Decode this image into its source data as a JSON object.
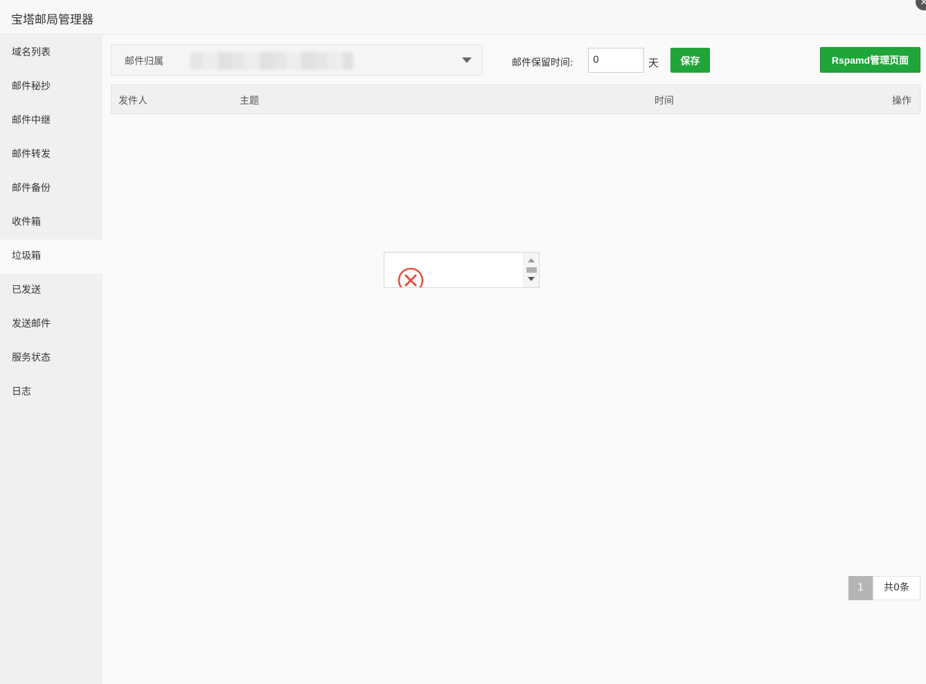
{
  "window": {
    "title": "宝塔邮局管理器",
    "close_symbol": "×"
  },
  "sidebar": {
    "items": [
      {
        "label": "域名列表"
      },
      {
        "label": "邮件秘抄"
      },
      {
        "label": "邮件中继"
      },
      {
        "label": "邮件转发"
      },
      {
        "label": "邮件备份"
      },
      {
        "label": "收件箱"
      },
      {
        "label": "垃圾箱",
        "active": true
      },
      {
        "label": "已发送"
      },
      {
        "label": "发送邮件"
      },
      {
        "label": "服务状态"
      },
      {
        "label": "日志"
      }
    ]
  },
  "toolbar": {
    "owner_label": "邮件归属",
    "retention_label": "邮件保留时间:",
    "retention_value": "0",
    "retention_unit": "天",
    "save_label": "保存",
    "rspamd_label": "Rspamd管理页面"
  },
  "table": {
    "columns": [
      "发件人",
      "主题",
      "时间",
      "操作"
    ],
    "rows": []
  },
  "pagination": {
    "current_page": "1",
    "total_text": "共0条"
  },
  "colors": {
    "accent": "#20a53a",
    "error": "#e74c3c"
  },
  "icons": {
    "close": "close-icon",
    "dropdown": "chevron-down-icon",
    "error": "error-circle-icon"
  }
}
